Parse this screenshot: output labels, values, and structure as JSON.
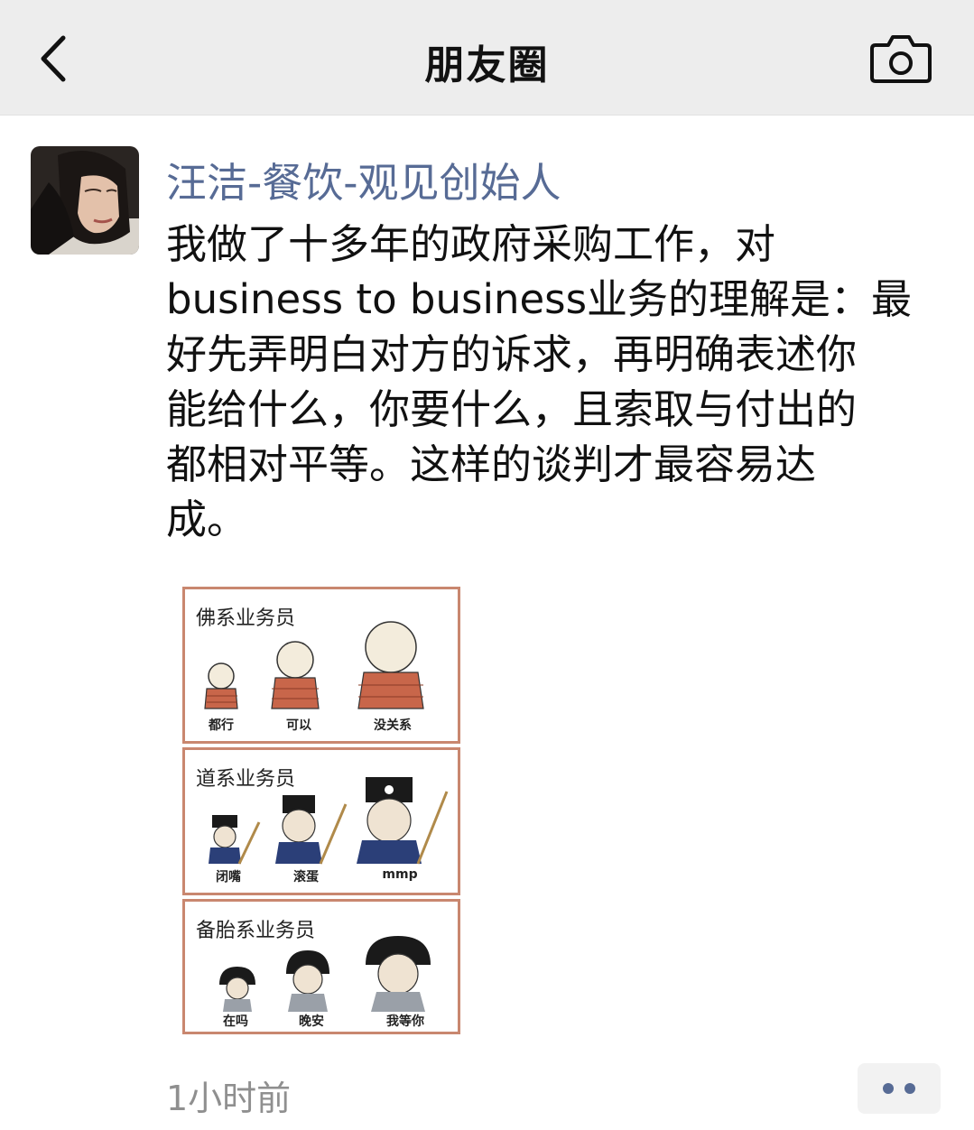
{
  "navbar": {
    "title": "朋友圈",
    "back_icon": "chevron-left-icon",
    "camera_icon": "camera-icon"
  },
  "post": {
    "author": "汪洁-餐饮-观见创始人",
    "text_lines": [
      "我做了十多年的政府采购工作，对",
      "business to business业务的理解是：最",
      "好先弄明白对方的诉求，再明确表述你",
      "能给什么，你要什么，且索取与付出的",
      "都相对平等。这样的谈判才最容易达",
      "成。"
    ],
    "timestamp": "1小时前",
    "more_icon": "more-dots-icon",
    "meme": {
      "panels": [
        {
          "title": "佛系业务员",
          "captions": [
            "都行",
            "可以",
            "没关系"
          ]
        },
        {
          "title": "道系业务员",
          "captions": [
            "闭嘴",
            "滚蛋",
            "mmp"
          ]
        },
        {
          "title": "备胎系业务员",
          "captions": [
            "在吗",
            "晚安",
            "我等你"
          ]
        }
      ]
    }
  },
  "colors": {
    "navbar_bg": "#ededed",
    "author_link": "#576b95",
    "timestamp": "#8f8f8f",
    "meme_border": "#c9876f"
  }
}
